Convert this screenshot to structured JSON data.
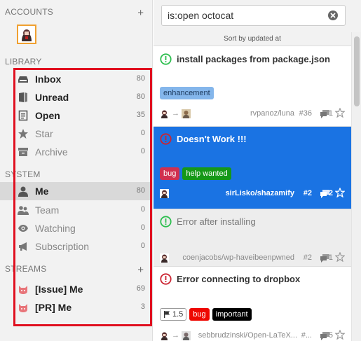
{
  "sidebar": {
    "accounts_title": "ACCOUNTS",
    "accounts_add": "+",
    "library_title": "LIBRARY",
    "library": [
      {
        "label": "Inbox",
        "count": "80",
        "icon": "inbox-icon"
      },
      {
        "label": "Unread",
        "count": "80",
        "icon": "book-icon"
      },
      {
        "label": "Open",
        "count": "35",
        "icon": "document-icon"
      },
      {
        "label": "Star",
        "count": "0",
        "icon": "star-icon"
      },
      {
        "label": "Archive",
        "count": "0",
        "icon": "archive-icon"
      }
    ],
    "system_title": "SYSTEM",
    "system": [
      {
        "label": "Me",
        "count": "80",
        "icon": "person-icon"
      },
      {
        "label": "Team",
        "count": "0",
        "icon": "team-icon"
      },
      {
        "label": "Watching",
        "count": "0",
        "icon": "eye-icon"
      },
      {
        "label": "Subscription",
        "count": "0",
        "icon": "megaphone-icon"
      }
    ],
    "streams_title": "STREAMS",
    "streams_add": "+",
    "streams": [
      {
        "label": "[Issue] Me",
        "count": "69",
        "icon": "octocat-icon"
      },
      {
        "label": "[PR] Me",
        "count": "3",
        "icon": "octocat-icon"
      }
    ]
  },
  "search": {
    "value": "is:open octocat"
  },
  "sort": {
    "label": "Sort by updated at"
  },
  "issues": [
    {
      "title": "install packages from package.json",
      "labels": [
        {
          "text": "enhancement",
          "color": "#84b6eb",
          "fg": "#1c3a5e"
        }
      ],
      "repo": "rvpanoz/luna",
      "number": "#36",
      "comments": "1",
      "state": "open"
    },
    {
      "title": "Doesn't Work !!!",
      "labels": [
        {
          "text": "bug",
          "color": "#ee0701",
          "fg": "#ffffff"
        },
        {
          "text": "help wanted",
          "color": "#159818",
          "fg": "#ffffff"
        }
      ],
      "repo": "sirLisko/shazamify",
      "number": "#2",
      "comments": "2",
      "state": "open"
    },
    {
      "title": "Error after installing",
      "repo": "coenjacobs/wp-haveibeenpwned",
      "number": "#2",
      "comments": "1",
      "state": "open"
    },
    {
      "title": "Error connecting to dropbox",
      "milestone": "1.5",
      "labels": [
        {
          "text": "bug",
          "color": "#ee0701",
          "fg": "#ffffff"
        },
        {
          "text": "important",
          "color": "#000000",
          "fg": "#ffffff"
        }
      ],
      "repo": "sebbrudzinski/Open-LaTeX...",
      "number": "#...",
      "comments": "5",
      "state": "open"
    }
  ],
  "colors": {
    "accent": "#1a73e3",
    "open": "#2cbe4e",
    "bug": "#cb2431",
    "frame": "#e01020"
  }
}
